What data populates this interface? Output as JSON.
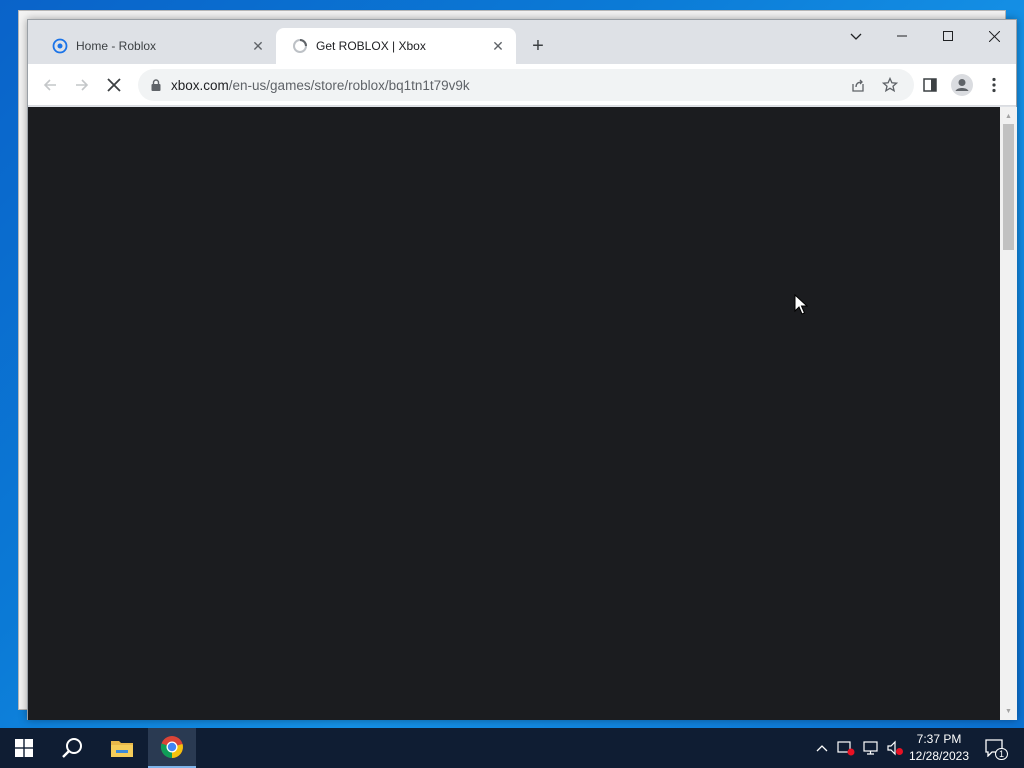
{
  "browser": {
    "tabs": [
      {
        "title": "Home - Roblox",
        "active": false
      },
      {
        "title": "Get ROBLOX | Xbox",
        "active": true
      }
    ],
    "new_tab_symbol": "+",
    "address": {
      "domain": "xbox.com",
      "path": "/en-us/games/store/roblox/bq1tn1t79v9k"
    },
    "loading": true
  },
  "icons": {
    "back": "back-arrow-icon",
    "forward": "forward-arrow-icon",
    "stop": "stop-loading-icon",
    "lock": "lock-icon",
    "share": "share-icon",
    "bookmark": "star-icon",
    "side_panel": "side-panel-icon",
    "profile": "profile-icon",
    "menu": "kebab-menu-icon"
  },
  "colors": {
    "page_background": "#1b1c1f",
    "tabstrip": "#dee1e6",
    "taskbar": "#0f1d33",
    "desktop": "#0b7ad6"
  },
  "taskbar": {
    "apps": [
      "start",
      "search",
      "file-explorer",
      "chrome"
    ],
    "active_app": "chrome",
    "clock": {
      "time": "7:37 PM",
      "date": "12/28/2023"
    },
    "notification_count": "1"
  }
}
